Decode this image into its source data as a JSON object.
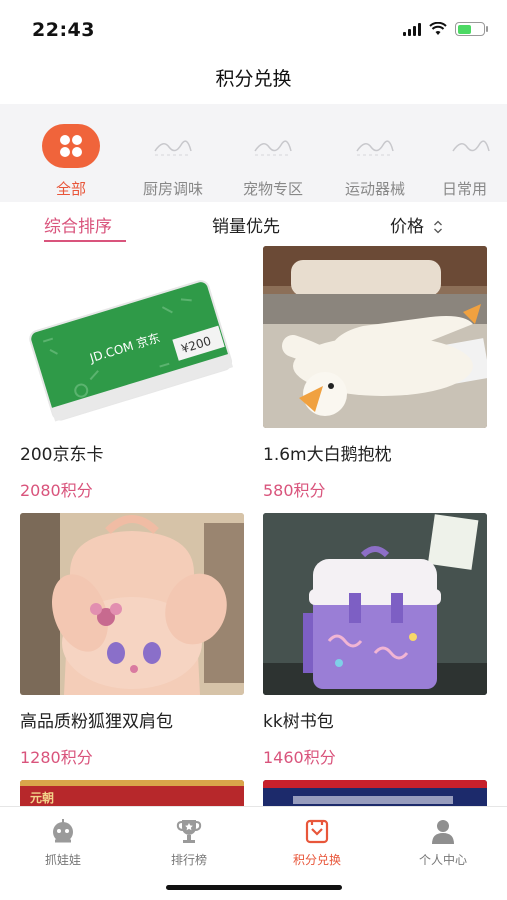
{
  "status_bar": {
    "time": "22:43"
  },
  "nav": {
    "title": "积分兑换"
  },
  "categories": [
    {
      "label": "全部",
      "icon": "grid-icon",
      "active": true
    },
    {
      "label": "厨房调味",
      "icon": "placeholder-icon",
      "active": false
    },
    {
      "label": "宠物专区",
      "icon": "placeholder-icon",
      "active": false
    },
    {
      "label": "运动器械",
      "icon": "placeholder-icon",
      "active": false
    },
    {
      "label": "日常用",
      "icon": "placeholder-icon",
      "active": false
    }
  ],
  "sort": {
    "comprehensive": "综合排序",
    "sales": "销量优先",
    "price": "价格"
  },
  "products": [
    {
      "title": "200京东卡",
      "price": "2080积分",
      "image": "jd-card-image",
      "card_text": "JD.COM 京东",
      "card_value": "¥200"
    },
    {
      "title": "1.6m大白鹅抱枕",
      "price": "580积分",
      "image": "goose-pillow-image"
    },
    {
      "title": "高品质粉狐狸双肩包",
      "price": "1280积分",
      "image": "pink-fox-backpack-image"
    },
    {
      "title": "kk树书包",
      "price": "1460积分",
      "image": "schoolbag-image"
    }
  ],
  "partial_cards": [
    {
      "image": "red-banner-image",
      "label": "元朝"
    },
    {
      "image": "navy-banner-image",
      "label": ""
    }
  ],
  "tabs": [
    {
      "label": "抓娃娃",
      "icon": "claw-machine-icon",
      "active": false
    },
    {
      "label": "排行榜",
      "icon": "trophy-icon",
      "active": false
    },
    {
      "label": "积分兑换",
      "icon": "gift-exchange-icon",
      "active": true
    },
    {
      "label": "个人中心",
      "icon": "user-icon",
      "active": false
    }
  ],
  "colors": {
    "accent": "#d9547c",
    "brand_orange": "#f0643b"
  }
}
